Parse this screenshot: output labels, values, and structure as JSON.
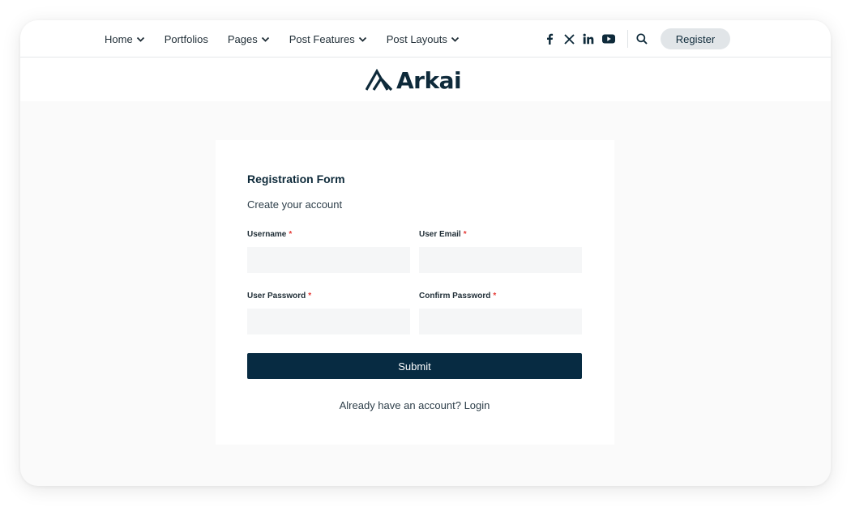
{
  "nav": {
    "items": [
      {
        "label": "Home",
        "has_dropdown": true
      },
      {
        "label": "Portfolios",
        "has_dropdown": false
      },
      {
        "label": "Pages",
        "has_dropdown": true
      },
      {
        "label": "Post Features",
        "has_dropdown": true
      },
      {
        "label": "Post Layouts",
        "has_dropdown": true
      }
    ],
    "social_icons": [
      "facebook-icon",
      "x-icon",
      "linkedin-icon",
      "youtube-icon"
    ],
    "search_icon": "search-icon",
    "register_label": "Register"
  },
  "logo": {
    "text": "Arkai"
  },
  "form": {
    "title": "Registration Form",
    "subtitle": "Create your account",
    "required_mark": "*",
    "fields": [
      {
        "label": "Username",
        "value": "",
        "placeholder": ""
      },
      {
        "label": "User Email",
        "value": "",
        "placeholder": ""
      },
      {
        "label": "User Password",
        "value": "",
        "placeholder": ""
      },
      {
        "label": "Confirm Password",
        "value": "",
        "placeholder": ""
      }
    ],
    "submit_label": "Submit",
    "login_prompt": "Already have an account?",
    "login_link": "Login"
  },
  "colors": {
    "brand_dark": "#072b42",
    "required": "#e53935",
    "page_bg": "#fafafa",
    "register_bg": "#e1e5e8"
  }
}
